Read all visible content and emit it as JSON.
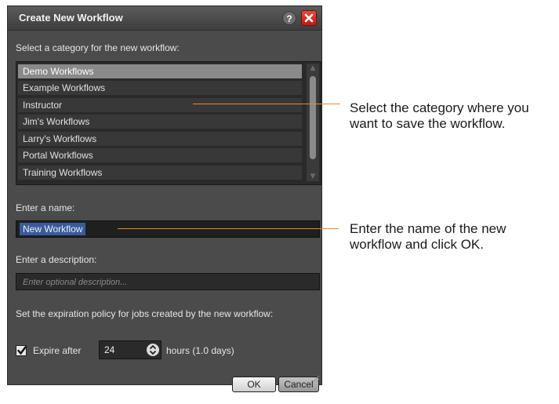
{
  "dialog": {
    "title": "Create New Workflow",
    "help_label": "?",
    "category_label": "Select a category for the new workflow:",
    "categories": [
      "Demo Workflows",
      "Example Workflows",
      "Instructor",
      "Jim's Workflows",
      "Larry's Workflows",
      "Portal Workflows",
      "Training Workflows"
    ],
    "selected_category": "Demo Workflows",
    "name_label": "Enter a name:",
    "name_value": "New Workflow",
    "description_label": "Enter a description:",
    "description_placeholder": "Enter optional description...",
    "expiration_label": "Set the expiration policy for jobs created by the new workflow:",
    "expire_checkbox_label": "Expire after",
    "expire_checked": true,
    "expire_value": "24",
    "expire_units": "hours (1.0 days)",
    "ok_label": "OK",
    "cancel_label": "Cancel"
  },
  "annotations": {
    "category": "Select the category where you want to save the workflow.",
    "name": "Enter the name of the new workflow and click OK."
  },
  "colors": {
    "dialog_bg": "#4b4b4b",
    "list_bg": "#2a2a2a",
    "selected_item": "#8a8a8a",
    "name_highlight": "#3a5a9a",
    "callout_line": "#e08b2e",
    "close_red": "#d6392b"
  },
  "icons": {
    "help": "help-icon",
    "close": "close-icon",
    "check": "checkmark-icon",
    "spinner": "up-down-arrows-icon",
    "resize": "resize-grip-icon"
  }
}
